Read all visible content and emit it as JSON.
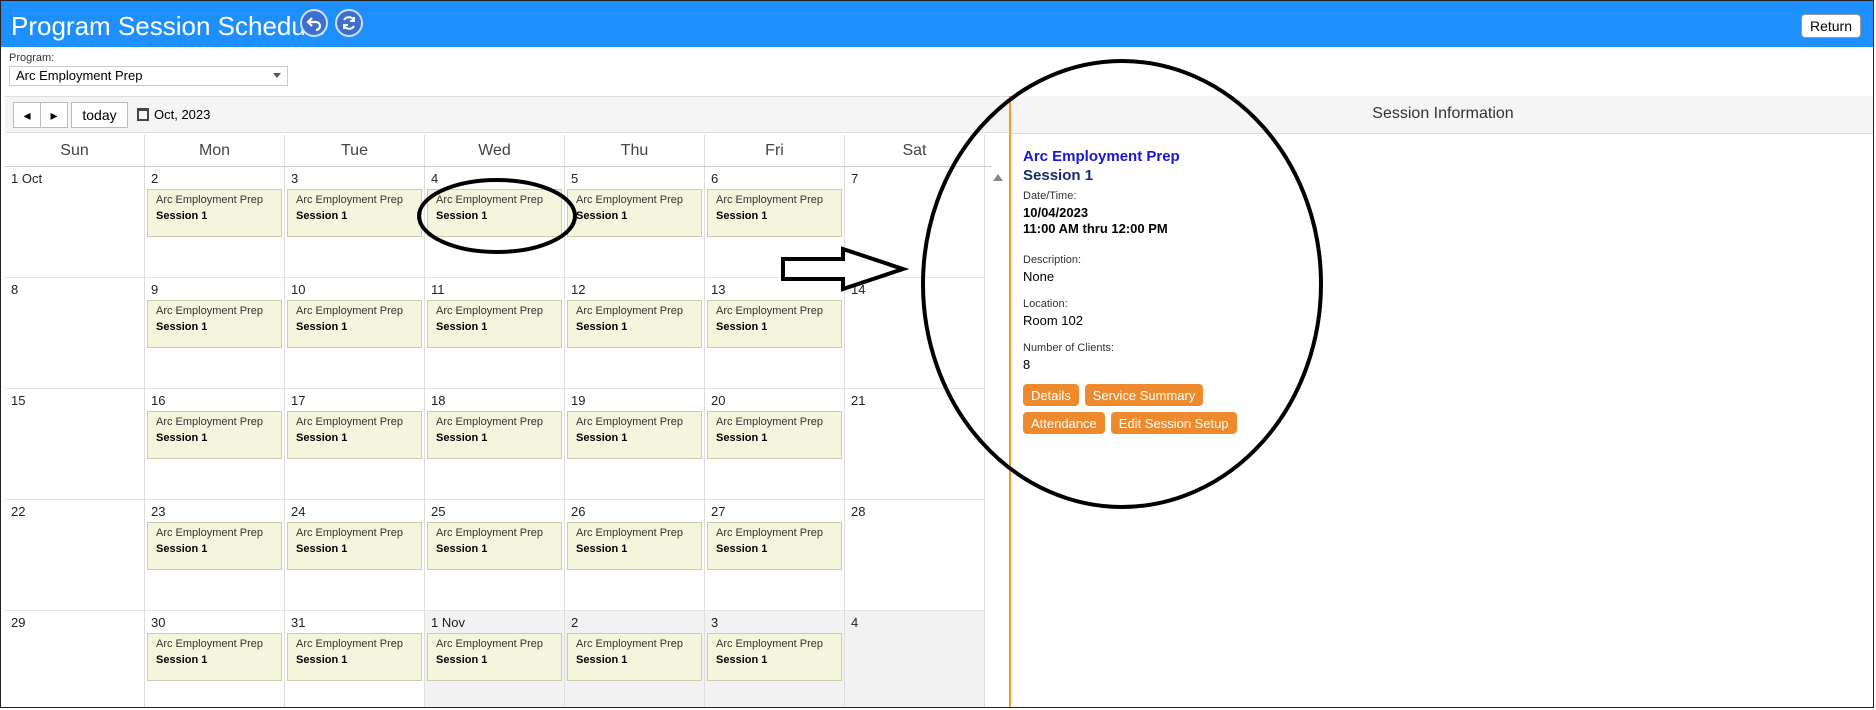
{
  "header": {
    "title": "Program Session Schedule",
    "return_label": "Return",
    "icons": [
      "undo-icon",
      "refresh-icon"
    ]
  },
  "program": {
    "label": "Program:",
    "selected": "Arc Employment Prep"
  },
  "toolbar": {
    "prev_icon": "◂",
    "next_icon": "▸",
    "today_label": "today",
    "month_label": "Oct, 2023"
  },
  "calendar": {
    "weekdays": [
      "Sun",
      "Mon",
      "Tue",
      "Wed",
      "Thu",
      "Fri",
      "Sat"
    ],
    "event": {
      "line1": "Arc Employment Prep",
      "line2": "Session 1"
    },
    "weeks": [
      {
        "days": [
          {
            "n": "1 Oct",
            "e": false,
            "o": false
          },
          {
            "n": "2",
            "e": true,
            "o": false
          },
          {
            "n": "3",
            "e": true,
            "o": false
          },
          {
            "n": "4",
            "e": true,
            "o": false
          },
          {
            "n": "5",
            "e": true,
            "o": false
          },
          {
            "n": "6",
            "e": true,
            "o": false
          },
          {
            "n": "7",
            "e": false,
            "o": false
          }
        ]
      },
      {
        "days": [
          {
            "n": "8",
            "e": false,
            "o": false
          },
          {
            "n": "9",
            "e": true,
            "o": false
          },
          {
            "n": "10",
            "e": true,
            "o": false
          },
          {
            "n": "11",
            "e": true,
            "o": false
          },
          {
            "n": "12",
            "e": true,
            "o": false
          },
          {
            "n": "13",
            "e": true,
            "o": false
          },
          {
            "n": "14",
            "e": false,
            "o": false
          }
        ]
      },
      {
        "days": [
          {
            "n": "15",
            "e": false,
            "o": false
          },
          {
            "n": "16",
            "e": true,
            "o": false
          },
          {
            "n": "17",
            "e": true,
            "o": false
          },
          {
            "n": "18",
            "e": true,
            "o": false
          },
          {
            "n": "19",
            "e": true,
            "o": false
          },
          {
            "n": "20",
            "e": true,
            "o": false
          },
          {
            "n": "21",
            "e": false,
            "o": false
          }
        ]
      },
      {
        "days": [
          {
            "n": "22",
            "e": false,
            "o": false
          },
          {
            "n": "23",
            "e": true,
            "o": false
          },
          {
            "n": "24",
            "e": true,
            "o": false
          },
          {
            "n": "25",
            "e": true,
            "o": false
          },
          {
            "n": "26",
            "e": true,
            "o": false
          },
          {
            "n": "27",
            "e": true,
            "o": false
          },
          {
            "n": "28",
            "e": false,
            "o": false
          }
        ]
      },
      {
        "days": [
          {
            "n": "29",
            "e": false,
            "o": false
          },
          {
            "n": "30",
            "e": true,
            "o": false
          },
          {
            "n": "31",
            "e": true,
            "o": false
          },
          {
            "n": "1 Nov",
            "e": true,
            "o": true
          },
          {
            "n": "2",
            "e": true,
            "o": true
          },
          {
            "n": "3",
            "e": true,
            "o": true
          },
          {
            "n": "4",
            "e": false,
            "o": true
          }
        ]
      }
    ]
  },
  "session_info": {
    "title": "Session Information",
    "program": "Arc Employment Prep",
    "session": "Session 1",
    "datetime_label": "Date/Time:",
    "date": "10/04/2023",
    "time": "11:00 AM thru 12:00 PM",
    "description_label": "Description:",
    "description": "None",
    "location_label": "Location:",
    "location": "Room 102",
    "clients_label": "Number of Clients:",
    "clients": "8",
    "buttons": {
      "details": "Details",
      "service_summary": "Service Summary",
      "attendance": "Attendance",
      "edit_setup": "Edit Session Setup"
    }
  },
  "colors": {
    "header": "#1e8fff",
    "event_bg": "#f4f5dc",
    "action_button": "#ee8a2e",
    "panel_border": "#f39c2b",
    "program_link": "#1616d6"
  }
}
